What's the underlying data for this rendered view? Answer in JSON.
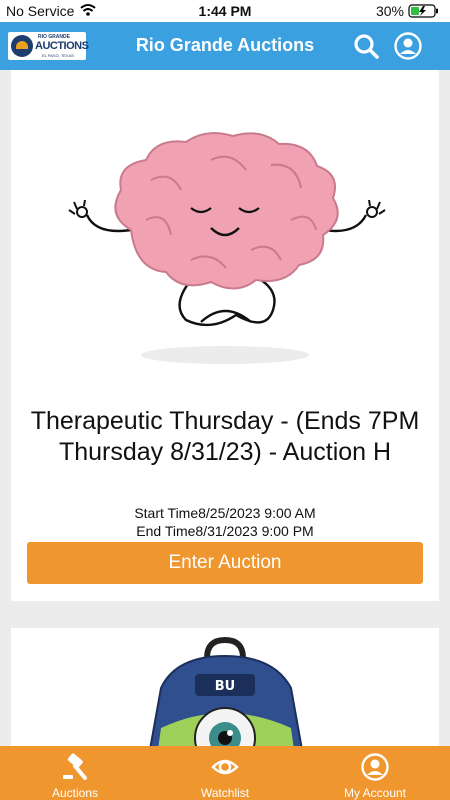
{
  "status_bar": {
    "carrier": "No Service",
    "time": "1:44 PM",
    "battery": "30%"
  },
  "header": {
    "logo_top": "RIO GRANDE",
    "logo_main": "AUCTIONS",
    "logo_sub": "EL PASO, TEXAS",
    "title": "Rio Grande Auctions",
    "brand_color": "#3aa0e0"
  },
  "auctions": [
    {
      "image": "meditating-brain-illustration",
      "title": "Therapeutic Thursday - (Ends 7PM Thursday 8/31/23) - Auction H",
      "start_time": "Start Time8/25/2023 9:00 AM",
      "end_time": "End Time8/31/2023 9:00 PM",
      "button_label": "Enter Auction"
    },
    {
      "image": "one-eyed-monster-backpack"
    }
  ],
  "accent_color": "#f0962f",
  "tabs": [
    {
      "label": "Auctions",
      "icon": "gavel-icon"
    },
    {
      "label": "Watchlist",
      "icon": "eye-icon"
    },
    {
      "label": "My Account",
      "icon": "account-icon"
    }
  ]
}
